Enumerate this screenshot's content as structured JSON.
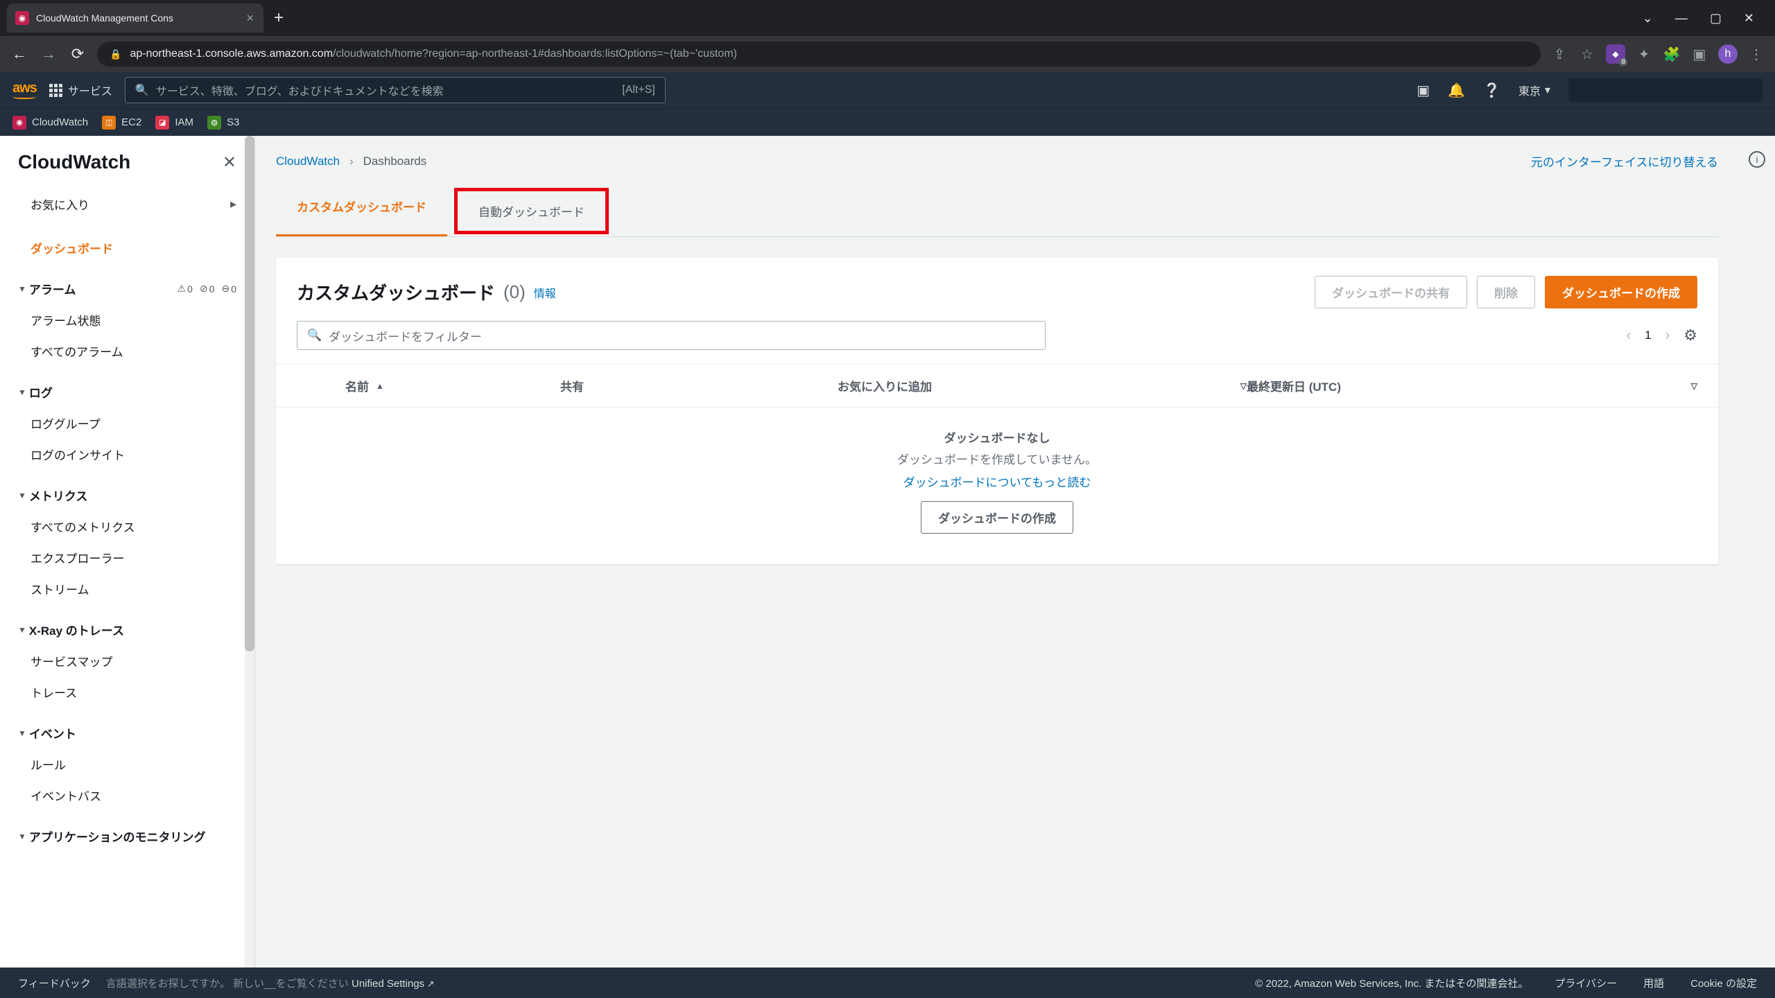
{
  "browser": {
    "tab_title": "CloudWatch Management Cons",
    "url_host": "ap-northeast-1.console.aws.amazon.com",
    "url_path": "/cloudwatch/home?region=ap-northeast-1#dashboards:listOptions=~(tab~'custom)",
    "avatar_letter": "h",
    "ext_badge": "8"
  },
  "aws_header": {
    "services": "サービス",
    "search_placeholder": "サービス、特徴、ブログ、およびドキュメントなどを検索",
    "search_shortcut": "[Alt+S]",
    "region": "東京"
  },
  "bookmarks": [
    {
      "label": "CloudWatch",
      "color": "#c0214f"
    },
    {
      "label": "EC2",
      "color": "#e47911"
    },
    {
      "label": "IAM",
      "color": "#dd344c"
    },
    {
      "label": "S3",
      "color": "#3f8624"
    }
  ],
  "sidebar": {
    "title": "CloudWatch",
    "favorites": "お気に入り",
    "dashboards": "ダッシュボード",
    "groups": [
      {
        "label": "アラーム",
        "has_alarms": true,
        "alarms": [
          "0",
          "0",
          "0"
        ],
        "items": [
          "アラーム状態",
          "すべてのアラーム"
        ]
      },
      {
        "label": "ログ",
        "items": [
          "ロググループ",
          "ログのインサイト"
        ]
      },
      {
        "label": "メトリクス",
        "items": [
          "すべてのメトリクス",
          "エクスプローラー",
          "ストリーム"
        ]
      },
      {
        "label": "X-Ray のトレース",
        "items": [
          "サービスマップ",
          "トレース"
        ]
      },
      {
        "label": "イベント",
        "items": [
          "ルール",
          "イベントバス"
        ]
      },
      {
        "label": "アプリケーションのモニタリング",
        "items": []
      }
    ]
  },
  "breadcrumb": {
    "root": "CloudWatch",
    "current": "Dashboards",
    "switch": "元のインターフェイスに切り替える"
  },
  "tabs": {
    "custom": "カスタムダッシュボード",
    "auto": "自動ダッシュボード"
  },
  "panel": {
    "title": "カスタムダッシュボード",
    "count": "(0)",
    "info": "情報",
    "share": "ダッシュボードの共有",
    "delete": "削除",
    "create": "ダッシュボードの作成",
    "filter_placeholder": "ダッシュボードをフィルター",
    "page": "1",
    "columns": {
      "name": "名前",
      "share": "共有",
      "fav": "お気に入りに追加",
      "date": "最終更新日 (UTC)"
    },
    "empty": {
      "title": "ダッシュボードなし",
      "desc": "ダッシュボードを作成していません。",
      "link": "ダッシュボードについてもっと読む",
      "create": "ダッシュボードの作成"
    }
  },
  "footer": {
    "feedback": "フィードバック",
    "lang": "言語選択をお探しですか。 新しい__をご覧ください",
    "unified": "Unified Settings",
    "copyright": "© 2022, Amazon Web Services, Inc. またはその関連会社。",
    "privacy": "プライバシー",
    "terms": "用語",
    "cookie": "Cookie の設定"
  }
}
